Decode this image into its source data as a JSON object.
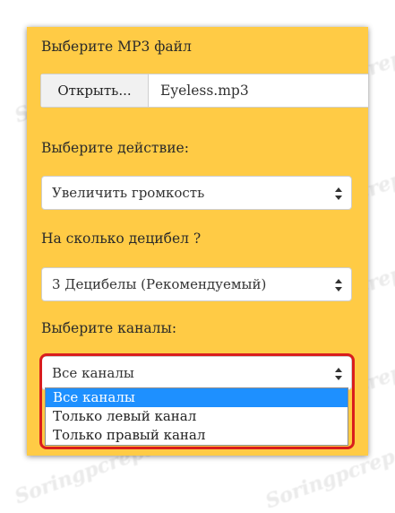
{
  "form": {
    "file_label": "Выберите MP3 файл",
    "file_button": "Открыть...",
    "file_name": "Eyeless.mp3",
    "action_label": "Выберите действие:",
    "action_value": "Увеличить громкость",
    "db_label": "На сколько децибел ?",
    "db_value": "3 Децибелы (Рекомендуемый)",
    "channels_label": "Выберите каналы:",
    "channels_value": "Все каналы",
    "channel_options": [
      "Все каналы",
      "Только левый канал",
      "Только правый канал"
    ],
    "selected_option_index": 0
  },
  "colors": {
    "panel": "#ffcb45",
    "highlight": "#d91d1d",
    "selected_option": "#1e90ff"
  },
  "watermark": {
    "text": "Soringpcrepair.Com"
  },
  "icons": {
    "select_arrow": "up-down-arrows-icon"
  }
}
